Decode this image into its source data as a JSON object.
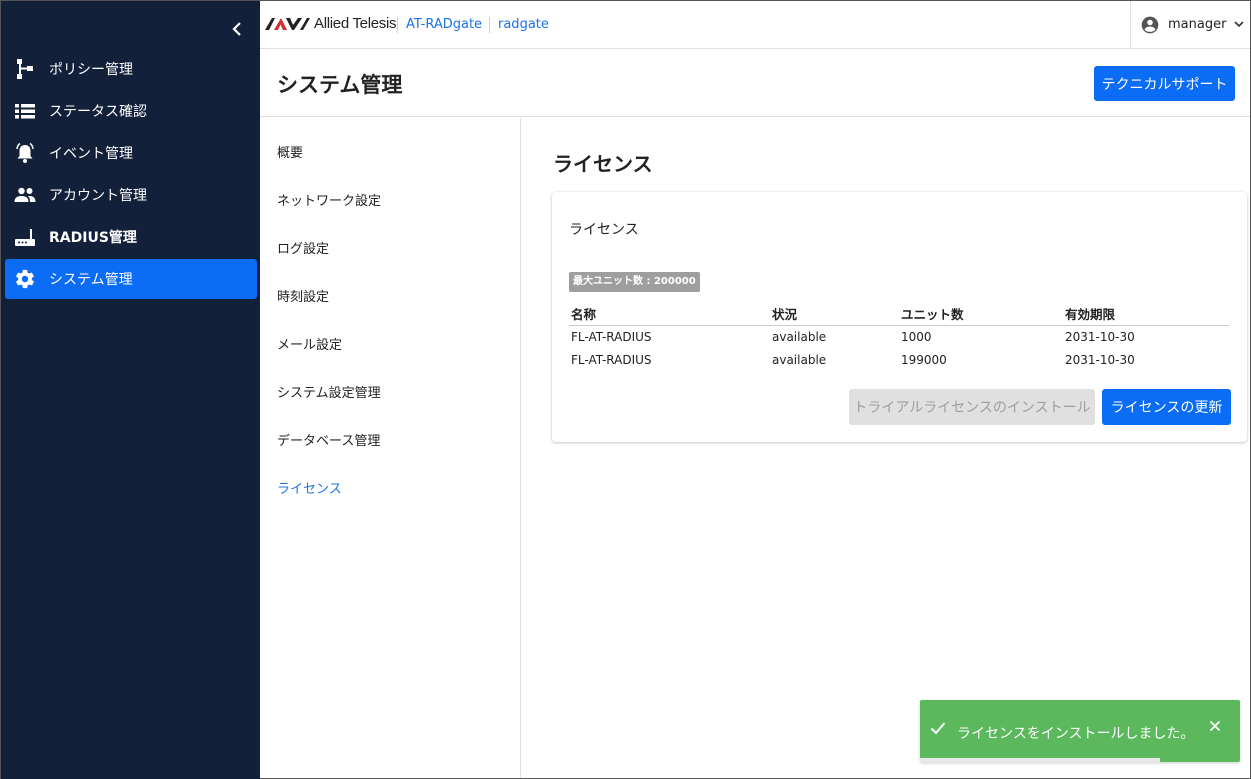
{
  "sidebar": {
    "items": [
      {
        "label": "ポリシー管理",
        "icon": "policy-tree-icon",
        "active": false
      },
      {
        "label": "ステータス確認",
        "icon": "list-icon",
        "active": false
      },
      {
        "label": "イベント管理",
        "icon": "alarm-bell-icon",
        "active": false
      },
      {
        "label": "アカウント管理",
        "icon": "people-icon",
        "active": false
      },
      {
        "label": "RADIUS管理",
        "icon": "router-icon",
        "active": false
      },
      {
        "label": "システム管理",
        "icon": "gear-icon",
        "active": true
      }
    ]
  },
  "header": {
    "brand": "Allied Telesis",
    "product": "AT-RADgate",
    "host": "radgate",
    "user": "manager"
  },
  "page": {
    "title": "システム管理",
    "support_button": "テクニカルサポート"
  },
  "submenu": {
    "items": [
      "概要",
      "ネットワーク設定",
      "ログ設定",
      "時刻設定",
      "メール設定",
      "システム設定管理",
      "データベース管理",
      "ライセンス"
    ],
    "active_index": 7
  },
  "license": {
    "section_title": "ライセンス",
    "card_title": "ライセンス",
    "badge": "最大ユニット数 : 200000",
    "columns": [
      "名称",
      "状況",
      "ユニット数",
      "有効期限"
    ],
    "rows": [
      [
        "FL-AT-RADIUS",
        "available",
        "1000",
        "2031-10-30"
      ],
      [
        "FL-AT-RADIUS",
        "available",
        "199000",
        "2031-10-30"
      ]
    ],
    "trial_button": "トライアルライセンスのインストール",
    "update_button": "ライセンスの更新"
  },
  "toast": {
    "message": "ライセンスをインストールしました。",
    "progress": 0.75
  },
  "colors": {
    "sidebar_bg": "#13203a",
    "accent": "#0b6cf5",
    "success": "#5cb85c"
  }
}
